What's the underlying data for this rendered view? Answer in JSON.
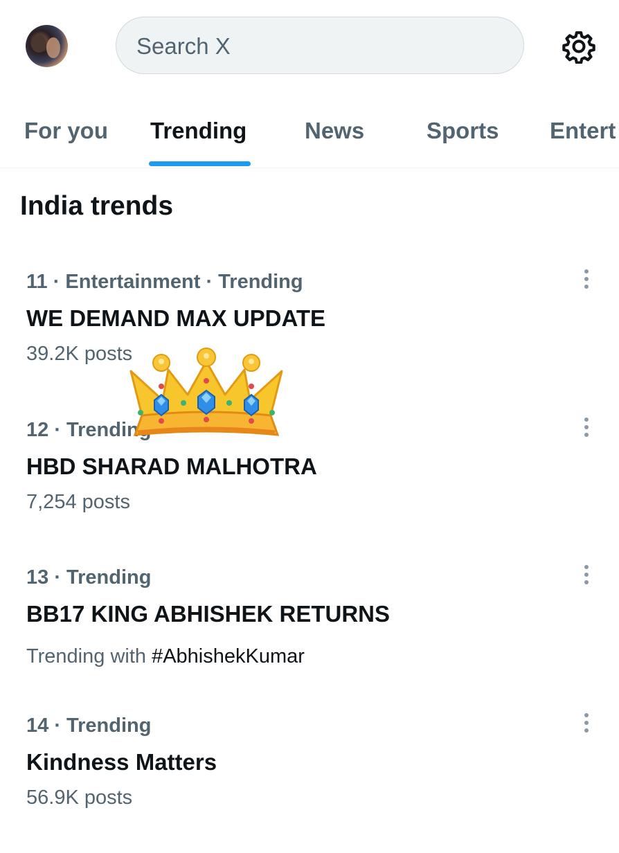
{
  "search": {
    "placeholder": "Search X"
  },
  "tabs": [
    {
      "label": "For you"
    },
    {
      "label": "Trending"
    },
    {
      "label": "News"
    },
    {
      "label": "Sports"
    },
    {
      "label": "Entert"
    }
  ],
  "section_title": "India trends",
  "trends": [
    {
      "meta": "11 · Entertainment · Trending",
      "name": "WE DEMAND MAX UPDATE",
      "posts": "39.2K posts"
    },
    {
      "meta": "12 · Trending",
      "name": "HBD SHARAD MALHOTRA",
      "posts": "7,254 posts"
    },
    {
      "meta": "13 · Trending",
      "name": "BB17 KING ABHISHEK RETURNS",
      "trending_with_label": "Trending with",
      "trending_with_tag": "#AbhishekKumar"
    },
    {
      "meta": "14 · Trending",
      "name": "Kindness Matters",
      "posts": "56.9K posts"
    }
  ],
  "icons": {
    "settings": "gear-icon",
    "more": "more-vertical-icon",
    "sticker": "crown-emoji"
  },
  "colors": {
    "accent": "#1d9bf0",
    "secondary_text": "#536471",
    "primary_text": "#0f1419"
  }
}
